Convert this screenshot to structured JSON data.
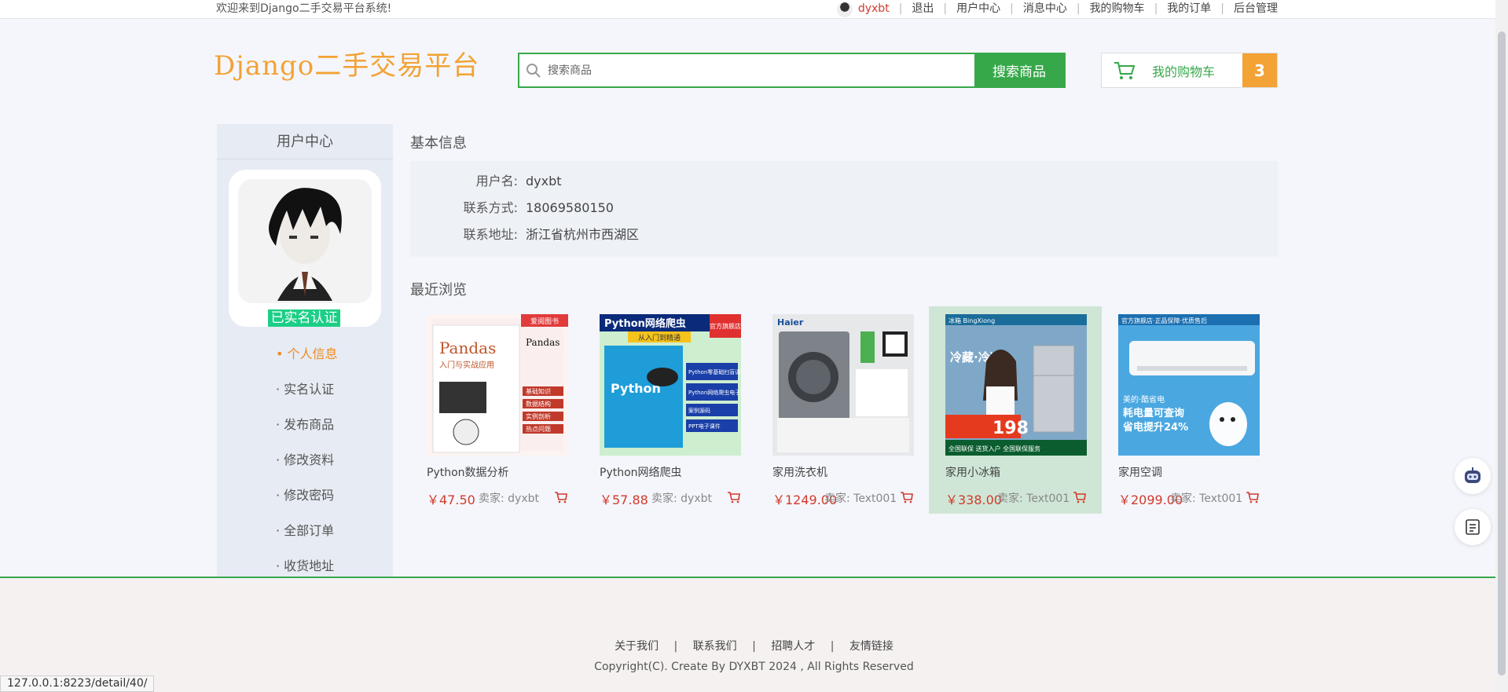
{
  "topbar": {
    "welcome": "欢迎来到Django二手交易平台系统!",
    "username": "dyxbt",
    "links": [
      "退出",
      "用户中心",
      "消息中心",
      "我的购物车",
      "我的订单",
      "后台管理"
    ]
  },
  "header": {
    "logo": "Django二手交易平台",
    "search_placeholder": "搜索商品",
    "search_button": "搜索商品",
    "cart_label": "我的购物车",
    "cart_count": "3"
  },
  "sidebar": {
    "title": "用户中心",
    "verified": "已实名认证",
    "menu": [
      "• 个人信息",
      "· 实名认证",
      "· 发布商品",
      "· 修改资料",
      "· 修改密码",
      "· 全部订单",
      "· 收货地址"
    ]
  },
  "basic_info": {
    "title": "基本信息",
    "rows": [
      {
        "label": "用户名:",
        "value": "dyxbt"
      },
      {
        "label": "联系方式:",
        "value": "18069580150"
      },
      {
        "label": "联系地址:",
        "value": "浙江省杭州市西湖区"
      }
    ]
  },
  "recent": {
    "title": "最近浏览",
    "products": [
      {
        "name": "Python数据分析",
        "price": "￥47.50",
        "seller": "卖家: dyxbt"
      },
      {
        "name": "Python网络爬虫",
        "price": "￥57.88",
        "seller": "卖家: dyxbt"
      },
      {
        "name": "家用洗衣机",
        "price": "￥1249.00",
        "seller": "卖家: Text001"
      },
      {
        "name": "家用小冰箱",
        "price": "￥338.00",
        "seller": "卖家: Text001"
      },
      {
        "name": "家用空调",
        "price": "￥2099.00",
        "seller": "卖家: Text001"
      }
    ]
  },
  "product_art": {
    "p1": {
      "title": "Pandas",
      "sub": "入门与实战应用",
      "badge": "爱阅图书",
      "tags": [
        "基础知识",
        "数据结构",
        "实例剖析",
        "热点问题"
      ]
    },
    "p2": {
      "header": "Python网络爬虫",
      "sub": "从入门到精通",
      "badge": "官方旗舰店",
      "word": "Python",
      "side": [
        "Python零基础扫盲课",
        "Python网络爬虫电子版题库",
        "案例源码",
        "PPT电子课件"
      ]
    },
    "p3": {
      "brand": "Haier"
    },
    "p4": {
      "brand": "冰箱 BingXiong",
      "lines": [
        "冷藏·冷冻"
      ],
      "price_tag": "198",
      "promo": "全国联保 送货入户 全国联保服务"
    },
    "p5": {
      "top": "官方旗舰店·正品保障·优质售后",
      "text1": "美的·酷省电",
      "text2": "耗电量可查询",
      "text3": "省电提升24%"
    }
  },
  "footer": {
    "links": [
      "关于我们",
      "联系我们",
      "招聘人才",
      "友情链接"
    ],
    "copyright": "Copyright(C). Create By DYXBT 2024 , All Rights Reserved"
  },
  "status_url": "127.0.0.1:8223/detail/40/",
  "colors": {
    "accent_green": "#37a84a",
    "accent_orange": "#f3a235",
    "price_red": "#d23a2c"
  }
}
